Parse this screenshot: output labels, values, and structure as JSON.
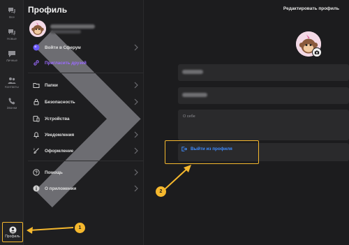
{
  "rail": {
    "items": [
      {
        "label": "Все",
        "icon": "chat-bubbles-icon"
      },
      {
        "label": "Новые",
        "icon": "chat-bubbles-icon"
      },
      {
        "label": "Личные",
        "icon": "chat-bubble-icon"
      },
      {
        "label": "Контакты",
        "icon": "contacts-icon"
      },
      {
        "label": "Звонки",
        "icon": "phone-icon"
      }
    ],
    "profile_label": "Профиль"
  },
  "panel": {
    "title": "Профиль",
    "sphere_label": "Войти в Сферум",
    "invite_label": "Пригласить друзей",
    "menu": [
      {
        "label": "Папки",
        "icon": "folder-icon"
      },
      {
        "label": "Безопасность",
        "icon": "lock-icon"
      },
      {
        "label": "Устройства",
        "icon": "devices-icon"
      },
      {
        "label": "Уведомления",
        "icon": "bell-icon"
      },
      {
        "label": "Оформление",
        "icon": "brush-icon"
      },
      {
        "label": "Помощь",
        "icon": "help-icon"
      },
      {
        "label": "О приложении",
        "icon": "info-icon"
      }
    ]
  },
  "main": {
    "edit_title": "Редактировать профиль",
    "about_placeholder": "О себе",
    "logout_label": "Выйти из профиля"
  },
  "callouts": {
    "one": "1",
    "two": "2"
  },
  "colors": {
    "accent": "#f5b82e",
    "link": "#3f8cff",
    "invite": "#9b6bff"
  }
}
